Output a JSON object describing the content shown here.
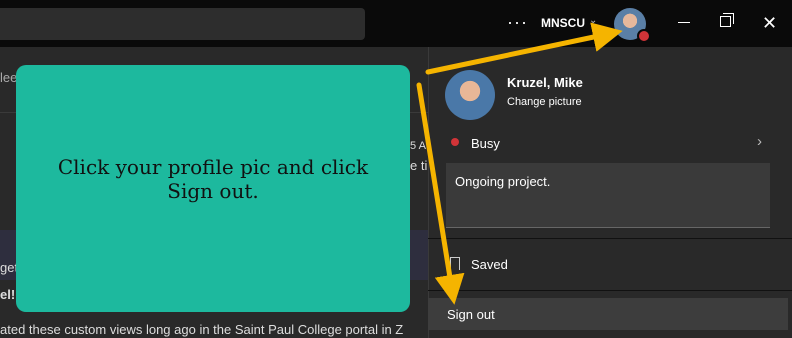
{
  "header": {
    "more_label": "···",
    "tenant": "MNSCU",
    "tenant_chevron": "⌄",
    "close_glyph": "✕"
  },
  "background": {
    "frag1": "lee",
    "frag2": "5 A",
    "frag3": "e ti",
    "frag4": "get",
    "frag5": "el!",
    "bottom_line": "ated these custom views long ago in the Saint Paul College portal in Z"
  },
  "callout": {
    "text": "Click your profile pic and click Sign out."
  },
  "profile_panel": {
    "name": "Kruzel, Mike",
    "change_picture": "Change picture",
    "status": "Busy",
    "status_chevron": "›",
    "status_message": "Ongoing project.",
    "saved": "Saved",
    "sign_out": "Sign out"
  },
  "colors": {
    "callout_bg": "#1db99e",
    "arrow": "#f5b400",
    "busy": "#d13438"
  }
}
